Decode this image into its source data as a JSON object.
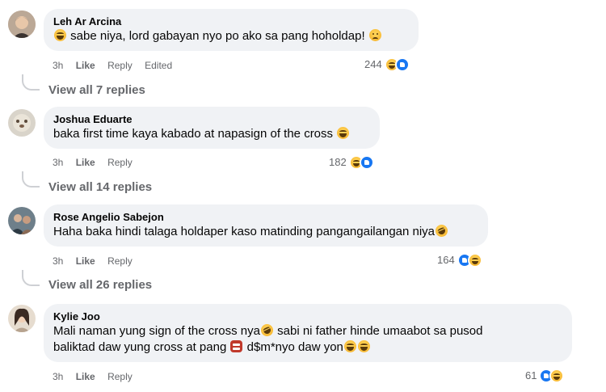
{
  "comments": [
    {
      "author": "Leh Ar Arcina",
      "text_before": "sabe niya, lord gabayan nyo po ako sa pang hoholdap!",
      "time": "3h",
      "like": "Like",
      "reply": "Reply",
      "edited": "Edited",
      "reaction_count": "244",
      "view_replies": "View all 7 replies"
    },
    {
      "author": "Joshua Eduarte",
      "text": "baka first time kaya kabado at napasign of the cross",
      "time": "3h",
      "like": "Like",
      "reply": "Reply",
      "reaction_count": "182",
      "view_replies": "View all 14 replies"
    },
    {
      "author": "Rose Angelio Sabejon",
      "text": "Haha baka hindi talaga holdaper kaso matinding pangangailangan niya",
      "time": "3h",
      "like": "Like",
      "reply": "Reply",
      "reaction_count": "164",
      "view_replies": "View all 26 replies"
    },
    {
      "author": "Kylie Joo",
      "line1_a": "Mali naman yung sign of the cross nya",
      "line1_b": "sabi ni father hinde umaabot sa pusod",
      "line2_a": "baliktad daw yung cross at pang",
      "line2_b": "d$m*nyo daw yon",
      "time": "3h",
      "like": "Like",
      "reply": "Reply",
      "reaction_count": "61"
    }
  ],
  "icons": {
    "like_color": "#1877f2",
    "reaction_haha": "haha-reaction-icon",
    "reaction_like": "like-reaction-icon"
  }
}
